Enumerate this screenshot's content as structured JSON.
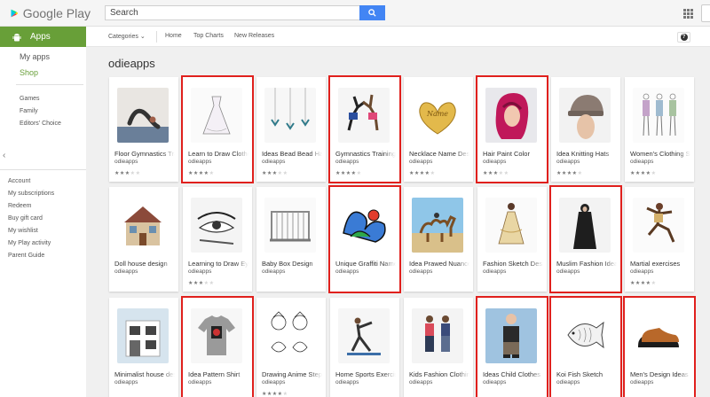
{
  "header": {
    "brand": "Google Play",
    "search_placeholder": "Search"
  },
  "subnav": {
    "section": "Apps",
    "items": [
      "Categories",
      "Home",
      "Top Charts",
      "New Releases"
    ]
  },
  "sidebar": {
    "main": [
      "My apps",
      "Shop"
    ],
    "sub": [
      "Games",
      "Family",
      "Editors' Choice"
    ],
    "account": [
      "Account",
      "My subscriptions",
      "Redeem",
      "Buy gift card",
      "My wishlist",
      "My Play activity",
      "Parent Guide"
    ]
  },
  "developer": "odieapps",
  "cards": [
    {
      "title": "Floor Gymnastics Training",
      "dev": "odieapps",
      "rating": 3,
      "highlight": false,
      "icon": "floor-gymnastics-icon"
    },
    {
      "title": "Learn to Draw Clothes",
      "dev": "odieapps",
      "rating": 4,
      "highlight": true,
      "icon": "dress-drawing-icon"
    },
    {
      "title": "Ideas Bead Bead Hair",
      "dev": "odieapps",
      "rating": 3,
      "highlight": false,
      "icon": "bead-necklace-icon"
    },
    {
      "title": "Gymnastics Training",
      "dev": "odieapps",
      "rating": 4,
      "highlight": true,
      "icon": "gymnastics-icon"
    },
    {
      "title": "Necklace Name Design",
      "dev": "odieapps",
      "rating": 4,
      "highlight": false,
      "icon": "name-necklace-icon"
    },
    {
      "title": "Hair Paint Color",
      "dev": "odieapps",
      "rating": 3,
      "highlight": true,
      "icon": "hair-color-icon"
    },
    {
      "title": "Idea Knitting Hats",
      "dev": "odieapps",
      "rating": 4,
      "highlight": false,
      "icon": "knit-hat-icon"
    },
    {
      "title": "Women's Clothing Sketch",
      "dev": "odieapps",
      "rating": 4,
      "highlight": false,
      "icon": "clothing-sketch-icon"
    },
    {
      "title": "Doll house design",
      "dev": "odieapps",
      "rating": 0,
      "highlight": false,
      "icon": "doll-house-icon"
    },
    {
      "title": "Learning to Draw Eyes",
      "dev": "odieapps",
      "rating": 3,
      "highlight": false,
      "icon": "eye-drawing-icon"
    },
    {
      "title": "Baby Box Design",
      "dev": "odieapps",
      "rating": 0,
      "highlight": false,
      "icon": "baby-crib-icon"
    },
    {
      "title": "Unique Graffiti Name",
      "dev": "odieapps",
      "rating": 0,
      "highlight": true,
      "icon": "graffiti-icon"
    },
    {
      "title": "Idea Prawed Nuance",
      "dev": "odieapps",
      "rating": 0,
      "highlight": false,
      "icon": "camel-beach-icon"
    },
    {
      "title": "Fashion Sketch Design",
      "dev": "odieapps",
      "rating": 0,
      "highlight": false,
      "icon": "fashion-sketch-icon"
    },
    {
      "title": "Muslim Fashion Ideas",
      "dev": "odieapps",
      "rating": 0,
      "highlight": true,
      "icon": "muslim-fashion-icon"
    },
    {
      "title": "Martial exercises",
      "dev": "odieapps",
      "rating": 4,
      "highlight": false,
      "icon": "martial-arts-icon"
    },
    {
      "title": "Minimalist house design",
      "dev": "odieapps",
      "rating": 0,
      "highlight": false,
      "icon": "house-icon"
    },
    {
      "title": "Idea Pattern Shirt",
      "dev": "odieapps",
      "rating": 0,
      "highlight": true,
      "icon": "tshirt-icon"
    },
    {
      "title": "Drawing Anime Step",
      "dev": "odieapps",
      "rating": 4,
      "highlight": false,
      "icon": "anime-drawing-icon"
    },
    {
      "title": "Home Sports Exercise",
      "dev": "odieapps",
      "rating": 0,
      "highlight": false,
      "icon": "home-exercise-icon"
    },
    {
      "title": "Kids Fashion Clothing",
      "dev": "odieapps",
      "rating": 0,
      "highlight": false,
      "icon": "kids-fashion-icon"
    },
    {
      "title": "Ideas Child Clothes",
      "dev": "odieapps",
      "rating": 0,
      "highlight": true,
      "icon": "child-clothes-icon"
    },
    {
      "title": "Koi Fish Sketch",
      "dev": "odieapps",
      "rating": 0,
      "highlight": true,
      "icon": "koi-fish-icon"
    },
    {
      "title": "Men's Design Ideas",
      "dev": "odieapps",
      "rating": 0,
      "highlight": true,
      "icon": "mens-shoes-icon"
    }
  ],
  "colors": {
    "accent": "#689f38",
    "search_button": "#4285f4",
    "highlight": "#e0201d"
  }
}
